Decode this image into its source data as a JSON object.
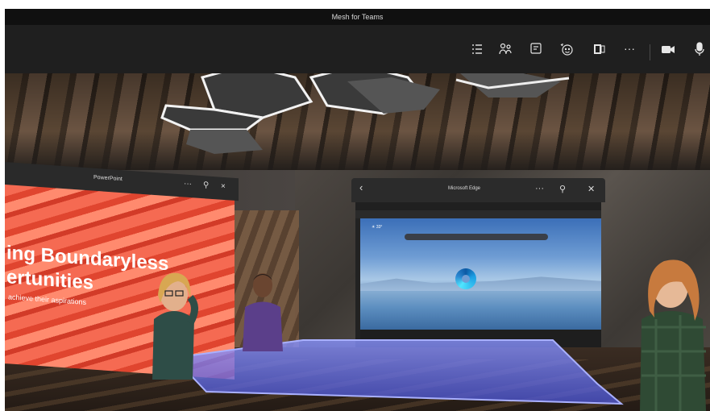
{
  "window": {
    "title": "Mesh for Teams"
  },
  "toolbar": {
    "items": [
      {
        "name": "list-icon"
      },
      {
        "name": "people-icon"
      },
      {
        "name": "chat-icon"
      },
      {
        "name": "reaction-icon"
      },
      {
        "name": "apps-icon"
      },
      {
        "name": "more-icon",
        "label": "···"
      },
      {
        "name": "camera-icon"
      },
      {
        "name": "microphone-icon"
      }
    ]
  },
  "ppt_panel": {
    "title": "PowerPoint",
    "more_label": "···",
    "pin_label": "⚲",
    "close_label": "×",
    "headline_line1": "ing Boundaryless",
    "headline_line2": "ertunities",
    "subtitle": "achieve their aspirations"
  },
  "edge_panel": {
    "title": "Microsoft Edge",
    "back_label": "‹",
    "more_label": "···",
    "pin_label": "⚲",
    "close_label": "✕",
    "weather": "☀ 33°"
  },
  "colors": {
    "titlebar": "#101010",
    "toolbar": "#1f1f1f",
    "slide": "#e0452f",
    "table_glow": "#6f7dff"
  }
}
